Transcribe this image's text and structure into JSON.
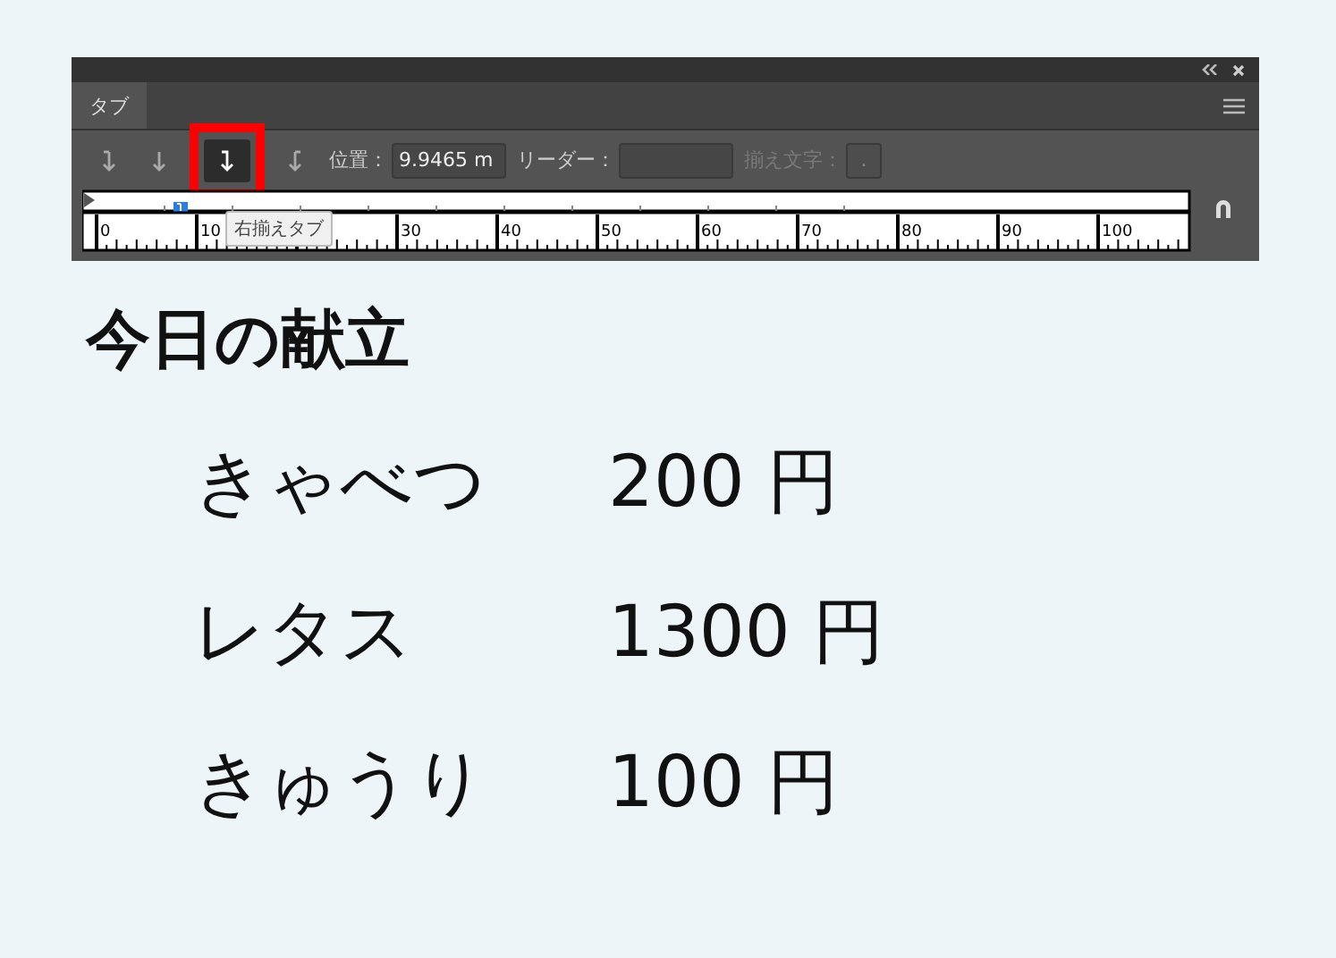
{
  "panel": {
    "tab": "タブ",
    "tab_buttons": [
      {
        "selected": false
      },
      {
        "selected": false
      },
      {
        "selected": true
      },
      {
        "selected": false
      }
    ],
    "position_label": "位置：",
    "position_value": "9.9465 m",
    "leader_label": "リーダー：",
    "align_label": "揃え文字：",
    "align_value": ".",
    "align_disabled": true,
    "tooltip": "右揃えタブ",
    "ruler_labels": [
      "0",
      "10",
      "30",
      "40",
      "50",
      "60",
      "70",
      "80",
      "90",
      "100"
    ]
  },
  "content": {
    "title": "今日の献立",
    "rows": [
      {
        "item": "きゃべつ",
        "price": "200 円"
      },
      {
        "item": "レタス",
        "price": "1300 円"
      },
      {
        "item": "きゅうり",
        "price": "100 円"
      }
    ]
  }
}
